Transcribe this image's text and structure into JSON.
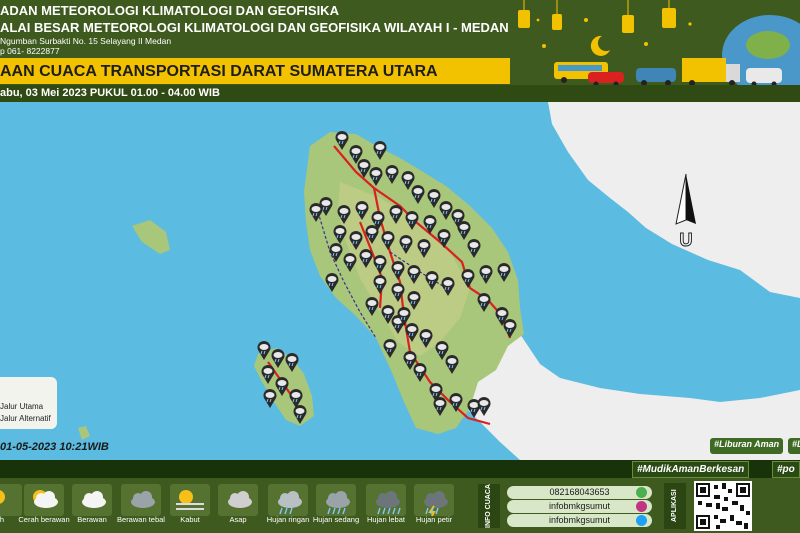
{
  "header": {
    "line1": "ADAN METEOROLOGI KLIMATOLOGI DAN GEOFISIKA",
    "line2": "ALAI BESAR METEOROLOGI KLIMATOLOGI DAN GEOFISIKA WILAYAH I - MEDAN",
    "address": "Ngumban Surbakti No. 15 Selayang II Medan",
    "phone": "p 061- 8222877",
    "title": "AAN CUACA TRANSPORTASI DARAT SUMATERA UTARA",
    "date": "abu, 03 Mei 2023 PUKUL 01.00 - 04.00 WIB"
  },
  "map": {
    "north_letter": "U",
    "colors": {
      "sea": "#5bbbe0",
      "land": "#a9c77a",
      "neighbour": "#eeeeee",
      "route": "#d9211f"
    }
  },
  "legend": {
    "items": [
      "Jalur Utama",
      "Jalur Alternatif"
    ]
  },
  "issued": "01-05-2023 10:21WIB",
  "tags": [
    "#Liburan Aman",
    "#L"
  ],
  "hashtags": [
    "#MudikAmanBerkesan",
    "#po"
  ],
  "weather_legend": [
    {
      "label": "h",
      "icon": "sun-icon"
    },
    {
      "label": "Cerah berawan",
      "icon": "sun-cloud-icon"
    },
    {
      "label": "Berawan",
      "icon": "cloud-icon"
    },
    {
      "label": "Berawan tebal",
      "icon": "dark-cloud-icon"
    },
    {
      "label": "Kabut",
      "icon": "fog-icon"
    },
    {
      "label": "Asap",
      "icon": "smoke-icon"
    },
    {
      "label": "Hujan ringan",
      "icon": "light-rain-icon"
    },
    {
      "label": "Hujan sedang",
      "icon": "moderate-rain-icon"
    },
    {
      "label": "Hujan lebat",
      "icon": "heavy-rain-icon"
    },
    {
      "label": "Hujan petir",
      "icon": "thunder-rain-icon"
    }
  ],
  "info": {
    "title": "INFO CUACA",
    "contacts": [
      {
        "text": "082168043653",
        "icon": "whatsapp-icon"
      },
      {
        "text": "infobmkgsumut",
        "icon": "instagram-icon"
      },
      {
        "text": "infobmkgsumut",
        "icon": "twitter-icon"
      }
    ],
    "app_label": "APLIKASI"
  }
}
